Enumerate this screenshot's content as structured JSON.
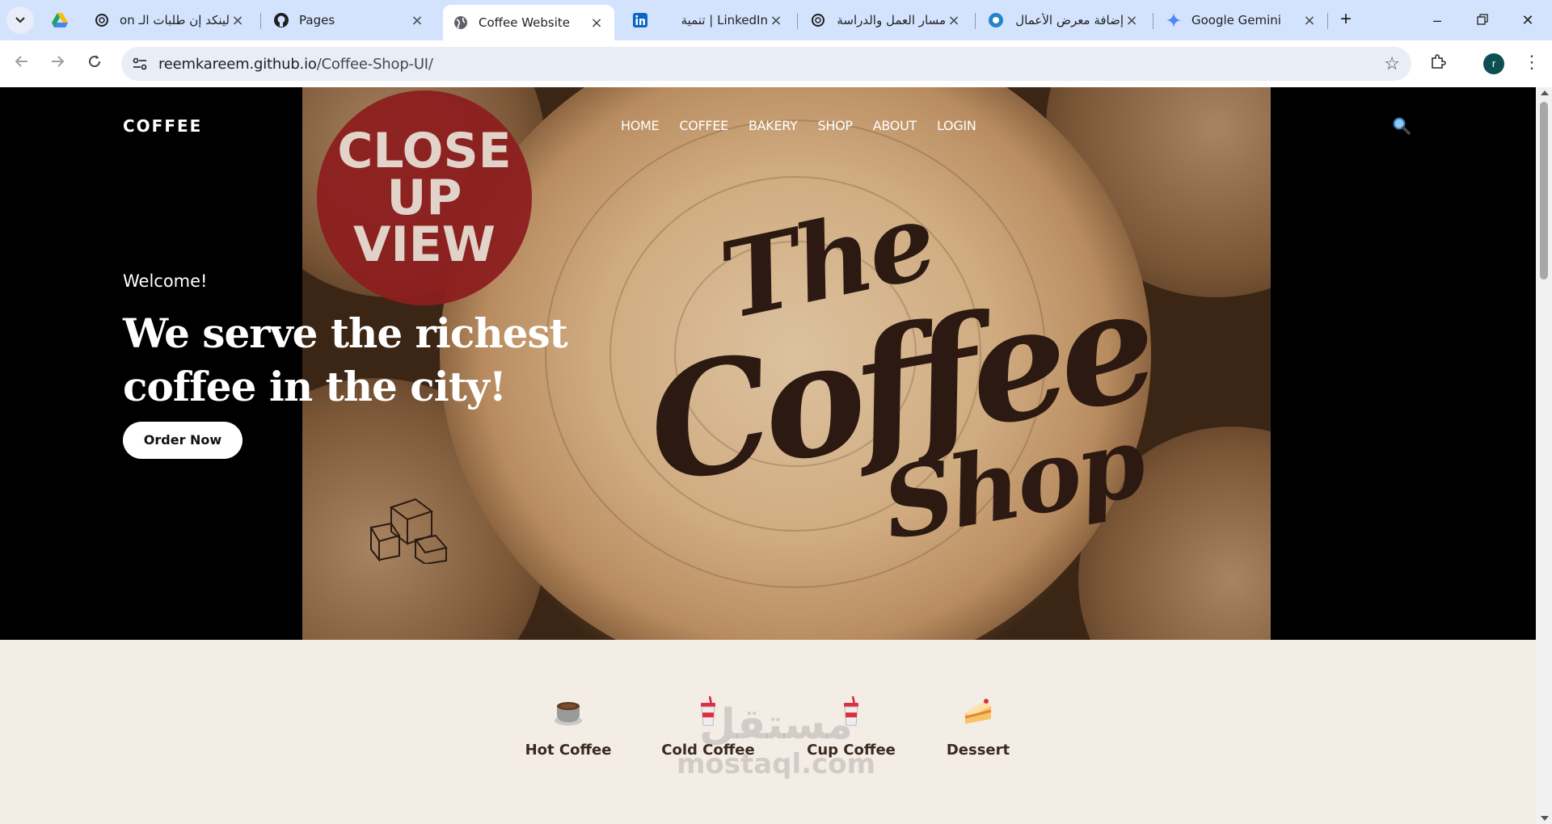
{
  "browser": {
    "tabs": [
      {
        "title": "لينكد إن طلبات الـ on",
        "favicon": "chatgpt-icon"
      },
      {
        "title": "Pages",
        "favicon": "github-icon"
      },
      {
        "title": "Coffee Website",
        "favicon": "globe-icon",
        "active": true
      },
      {
        "title": "تنمية | LinkedIn",
        "favicon": "linkedin-icon"
      },
      {
        "title": "مسار العمل والدراسة",
        "favicon": "chatgpt-icon"
      },
      {
        "title": "إضافة معرض الأعمال",
        "favicon": "mostaql-icon"
      },
      {
        "title": "Google Gemini",
        "favicon": "gemini-icon"
      }
    ],
    "url": {
      "host": "reemkareem.github.io",
      "path": "/Coffee-Shop-UI/"
    },
    "avatar_letter": "r"
  },
  "site": {
    "brand": "COFFEE",
    "nav": [
      "HOME",
      "COFFEE",
      "BAKERY",
      "SHOP",
      "ABOUT",
      "LOGIN"
    ],
    "hero": {
      "welcome": "Welcome!",
      "headline": "We serve the richest coffee in the city!",
      "cta": "Order Now",
      "badge_lines": [
        "CLOSE",
        "UP",
        "VIEW"
      ],
      "logo": {
        "the": "The",
        "coffee": "Coffee",
        "shop": "Shop"
      }
    },
    "categories": [
      {
        "label": "Hot Coffee",
        "icon": "hot-coffee-icon"
      },
      {
        "label": "Cold Coffee",
        "icon": "cold-drink-icon"
      },
      {
        "label": "Cup Coffee",
        "icon": "cup-drink-icon"
      },
      {
        "label": "Dessert",
        "icon": "cake-icon"
      }
    ]
  },
  "watermark": {
    "line1": "مستقل",
    "line2": "mostaql.com"
  },
  "colors": {
    "tabbar": "#d3e3fd",
    "hero_bg": "#000000",
    "categories_bg": "#f4ede6",
    "badge": "#8c1f1f"
  }
}
